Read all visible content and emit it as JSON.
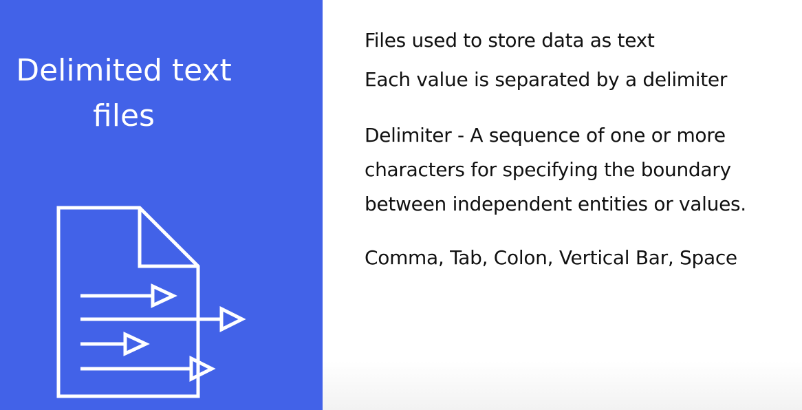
{
  "title": {
    "line1": "Delimited text",
    "line2": "files"
  },
  "icon": "delimited-file-icon",
  "colors": {
    "panel": "#4262e8",
    "title_text": "#ffffff",
    "body_text": "#111111"
  },
  "body": {
    "line1": "Files used to store data as text",
    "line2": "Each value is separated by a delimiter",
    "definition": [
      "Delimiter - A sequence of one or more",
      "characters for specifying the boundary",
      "between independent entities or values."
    ],
    "examples": "Comma, Tab, Colon, Vertical Bar, Space"
  }
}
